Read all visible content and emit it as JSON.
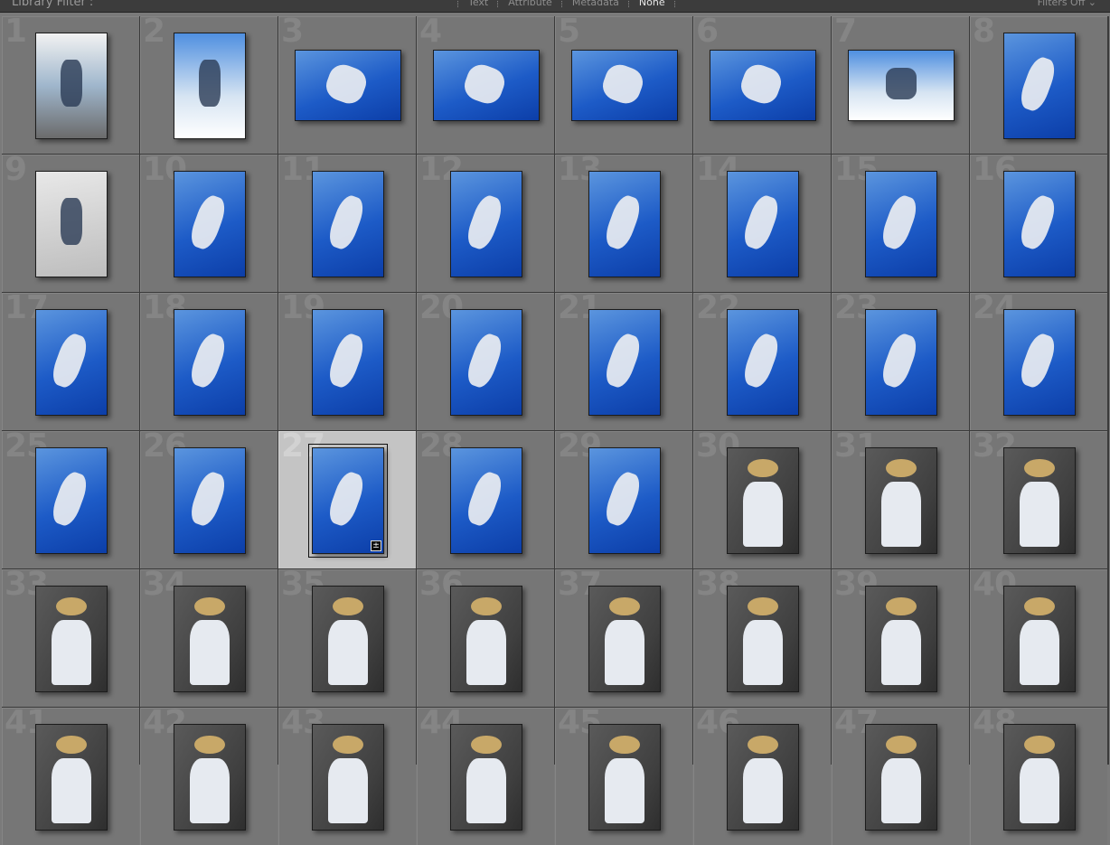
{
  "filter_bar": {
    "title": "Library Filter :",
    "options": [
      {
        "label": "Text",
        "active": false
      },
      {
        "label": "Attribute",
        "active": false
      },
      {
        "label": "Metadata",
        "active": false
      },
      {
        "label": "None",
        "active": true
      }
    ],
    "filters_state": "Filters Off ⌄"
  },
  "grid": {
    "columns": 8,
    "selected": 27,
    "cells": [
      {
        "n": "1",
        "scene": "hand"
      },
      {
        "n": "2",
        "scene": "sky2"
      },
      {
        "n": "3",
        "scene": "sky"
      },
      {
        "n": "4",
        "scene": "sky"
      },
      {
        "n": "5",
        "scene": "sky"
      },
      {
        "n": "6",
        "scene": "sky"
      },
      {
        "n": "7",
        "scene": "sky2"
      },
      {
        "n": "8",
        "scene": "sky"
      },
      {
        "n": "9",
        "scene": "concrete"
      },
      {
        "n": "10",
        "scene": "sky"
      },
      {
        "n": "11",
        "scene": "sky"
      },
      {
        "n": "12",
        "scene": "sky"
      },
      {
        "n": "13",
        "scene": "sky"
      },
      {
        "n": "14",
        "scene": "sky"
      },
      {
        "n": "15",
        "scene": "sky"
      },
      {
        "n": "16",
        "scene": "sky"
      },
      {
        "n": "17",
        "scene": "sky"
      },
      {
        "n": "18",
        "scene": "sky"
      },
      {
        "n": "19",
        "scene": "sky"
      },
      {
        "n": "20",
        "scene": "sky"
      },
      {
        "n": "21",
        "scene": "sky"
      },
      {
        "n": "22",
        "scene": "sky"
      },
      {
        "n": "23",
        "scene": "sky"
      },
      {
        "n": "24",
        "scene": "sky"
      },
      {
        "n": "25",
        "scene": "sky"
      },
      {
        "n": "26",
        "scene": "sky"
      },
      {
        "n": "27",
        "scene": "sky"
      },
      {
        "n": "28",
        "scene": "sky"
      },
      {
        "n": "29",
        "scene": "sky"
      },
      {
        "n": "30",
        "scene": "wall"
      },
      {
        "n": "31",
        "scene": "wall"
      },
      {
        "n": "32",
        "scene": "wall"
      },
      {
        "n": "33",
        "scene": "wall"
      },
      {
        "n": "34",
        "scene": "wall"
      },
      {
        "n": "35",
        "scene": "wall"
      },
      {
        "n": "36",
        "scene": "wall"
      },
      {
        "n": "37",
        "scene": "wall"
      },
      {
        "n": "38",
        "scene": "wall"
      },
      {
        "n": "39",
        "scene": "wall"
      },
      {
        "n": "40",
        "scene": "wall"
      },
      {
        "n": "41",
        "scene": "wall"
      },
      {
        "n": "42",
        "scene": "wall"
      },
      {
        "n": "43",
        "scene": "wall"
      },
      {
        "n": "44",
        "scene": "wall"
      },
      {
        "n": "45",
        "scene": "wall"
      },
      {
        "n": "46",
        "scene": "wall"
      },
      {
        "n": "47",
        "scene": "wall"
      },
      {
        "n": "48",
        "scene": "wall"
      }
    ]
  }
}
